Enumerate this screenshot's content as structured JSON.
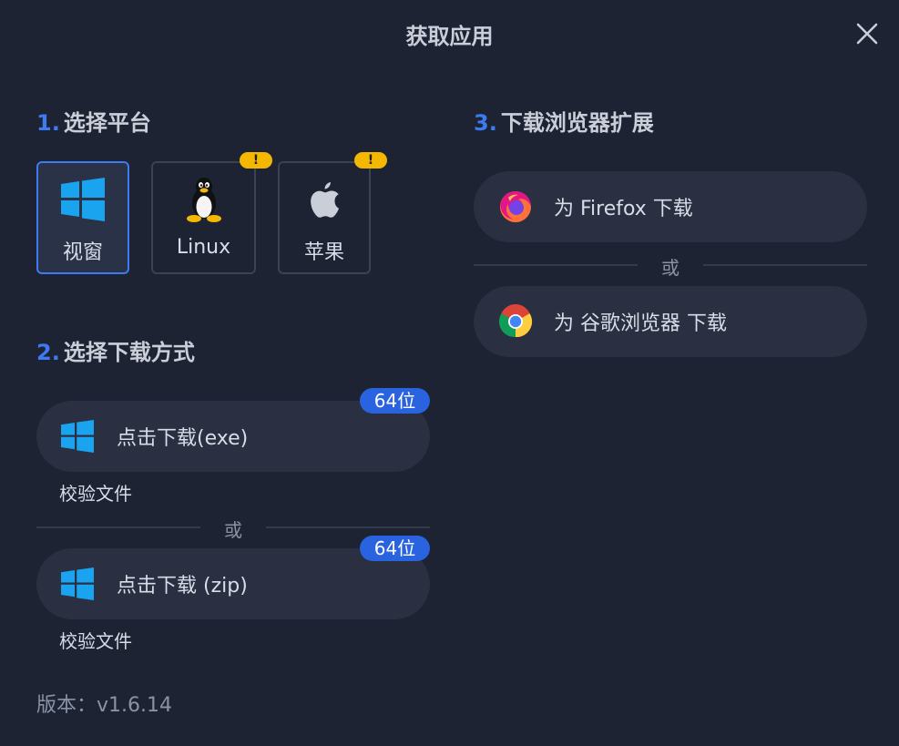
{
  "header": {
    "title": "获取应用"
  },
  "section1": {
    "num": "1.",
    "title": "选择平台",
    "platforms": [
      {
        "label": "视窗",
        "icon": "windows-logo-icon",
        "selected": true
      },
      {
        "label": "Linux",
        "icon": "linux-penguin-icon",
        "warning": "!"
      },
      {
        "label": "苹果",
        "icon": "apple-logo-icon",
        "warning": "!"
      }
    ]
  },
  "section2": {
    "num": "2.",
    "title": "选择下载方式",
    "options": [
      {
        "label": "点击下载(exe)",
        "badge": "64位",
        "verify": "校验文件",
        "icon": "windows-logo-icon"
      },
      {
        "label": "点击下载 (zip)",
        "badge": "64位",
        "verify": "校验文件",
        "icon": "windows-logo-icon"
      }
    ],
    "or": "或"
  },
  "section3": {
    "num": "3.",
    "title": "下载浏览器扩展",
    "firefox": {
      "label": "为 Firefox 下载",
      "icon": "firefox-icon"
    },
    "chrome": {
      "label": "为 谷歌浏览器 下载",
      "icon": "chrome-icon"
    },
    "or": "或"
  },
  "footer": {
    "version": "版本：v1.6.14"
  },
  "colors": {
    "background": "#1d2333",
    "accent": "#3d7bf2",
    "warning": "#f5b800",
    "badge": "#2a63e0",
    "pill": "#2a3042"
  }
}
